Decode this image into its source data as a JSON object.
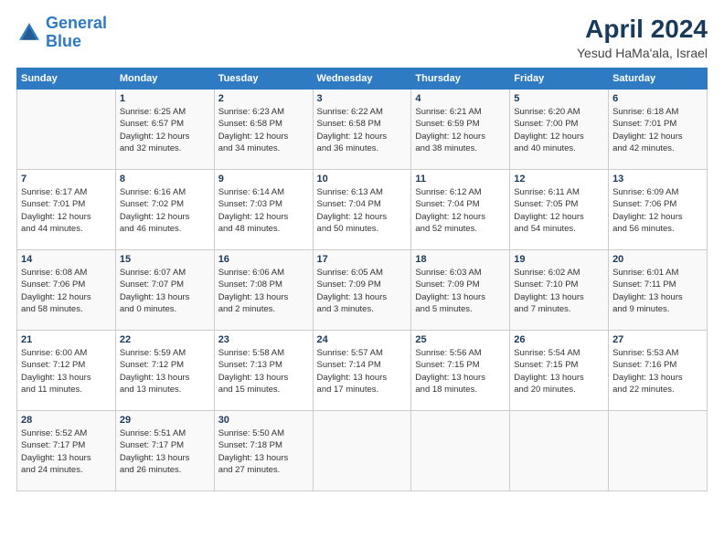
{
  "header": {
    "logo_general": "General",
    "logo_blue": "Blue",
    "title": "April 2024",
    "subtitle": "Yesud HaMa'ala, Israel"
  },
  "columns": [
    "Sunday",
    "Monday",
    "Tuesday",
    "Wednesday",
    "Thursday",
    "Friday",
    "Saturday"
  ],
  "weeks": [
    [
      {
        "day": "",
        "info": ""
      },
      {
        "day": "1",
        "info": "Sunrise: 6:25 AM\nSunset: 6:57 PM\nDaylight: 12 hours\nand 32 minutes."
      },
      {
        "day": "2",
        "info": "Sunrise: 6:23 AM\nSunset: 6:58 PM\nDaylight: 12 hours\nand 34 minutes."
      },
      {
        "day": "3",
        "info": "Sunrise: 6:22 AM\nSunset: 6:58 PM\nDaylight: 12 hours\nand 36 minutes."
      },
      {
        "day": "4",
        "info": "Sunrise: 6:21 AM\nSunset: 6:59 PM\nDaylight: 12 hours\nand 38 minutes."
      },
      {
        "day": "5",
        "info": "Sunrise: 6:20 AM\nSunset: 7:00 PM\nDaylight: 12 hours\nand 40 minutes."
      },
      {
        "day": "6",
        "info": "Sunrise: 6:18 AM\nSunset: 7:01 PM\nDaylight: 12 hours\nand 42 minutes."
      }
    ],
    [
      {
        "day": "7",
        "info": "Sunrise: 6:17 AM\nSunset: 7:01 PM\nDaylight: 12 hours\nand 44 minutes."
      },
      {
        "day": "8",
        "info": "Sunrise: 6:16 AM\nSunset: 7:02 PM\nDaylight: 12 hours\nand 46 minutes."
      },
      {
        "day": "9",
        "info": "Sunrise: 6:14 AM\nSunset: 7:03 PM\nDaylight: 12 hours\nand 48 minutes."
      },
      {
        "day": "10",
        "info": "Sunrise: 6:13 AM\nSunset: 7:04 PM\nDaylight: 12 hours\nand 50 minutes."
      },
      {
        "day": "11",
        "info": "Sunrise: 6:12 AM\nSunset: 7:04 PM\nDaylight: 12 hours\nand 52 minutes."
      },
      {
        "day": "12",
        "info": "Sunrise: 6:11 AM\nSunset: 7:05 PM\nDaylight: 12 hours\nand 54 minutes."
      },
      {
        "day": "13",
        "info": "Sunrise: 6:09 AM\nSunset: 7:06 PM\nDaylight: 12 hours\nand 56 minutes."
      }
    ],
    [
      {
        "day": "14",
        "info": "Sunrise: 6:08 AM\nSunset: 7:06 PM\nDaylight: 12 hours\nand 58 minutes."
      },
      {
        "day": "15",
        "info": "Sunrise: 6:07 AM\nSunset: 7:07 PM\nDaylight: 13 hours\nand 0 minutes."
      },
      {
        "day": "16",
        "info": "Sunrise: 6:06 AM\nSunset: 7:08 PM\nDaylight: 13 hours\nand 2 minutes."
      },
      {
        "day": "17",
        "info": "Sunrise: 6:05 AM\nSunset: 7:09 PM\nDaylight: 13 hours\nand 3 minutes."
      },
      {
        "day": "18",
        "info": "Sunrise: 6:03 AM\nSunset: 7:09 PM\nDaylight: 13 hours\nand 5 minutes."
      },
      {
        "day": "19",
        "info": "Sunrise: 6:02 AM\nSunset: 7:10 PM\nDaylight: 13 hours\nand 7 minutes."
      },
      {
        "day": "20",
        "info": "Sunrise: 6:01 AM\nSunset: 7:11 PM\nDaylight: 13 hours\nand 9 minutes."
      }
    ],
    [
      {
        "day": "21",
        "info": "Sunrise: 6:00 AM\nSunset: 7:12 PM\nDaylight: 13 hours\nand 11 minutes."
      },
      {
        "day": "22",
        "info": "Sunrise: 5:59 AM\nSunset: 7:12 PM\nDaylight: 13 hours\nand 13 minutes."
      },
      {
        "day": "23",
        "info": "Sunrise: 5:58 AM\nSunset: 7:13 PM\nDaylight: 13 hours\nand 15 minutes."
      },
      {
        "day": "24",
        "info": "Sunrise: 5:57 AM\nSunset: 7:14 PM\nDaylight: 13 hours\nand 17 minutes."
      },
      {
        "day": "25",
        "info": "Sunrise: 5:56 AM\nSunset: 7:15 PM\nDaylight: 13 hours\nand 18 minutes."
      },
      {
        "day": "26",
        "info": "Sunrise: 5:54 AM\nSunset: 7:15 PM\nDaylight: 13 hours\nand 20 minutes."
      },
      {
        "day": "27",
        "info": "Sunrise: 5:53 AM\nSunset: 7:16 PM\nDaylight: 13 hours\nand 22 minutes."
      }
    ],
    [
      {
        "day": "28",
        "info": "Sunrise: 5:52 AM\nSunset: 7:17 PM\nDaylight: 13 hours\nand 24 minutes."
      },
      {
        "day": "29",
        "info": "Sunrise: 5:51 AM\nSunset: 7:17 PM\nDaylight: 13 hours\nand 26 minutes."
      },
      {
        "day": "30",
        "info": "Sunrise: 5:50 AM\nSunset: 7:18 PM\nDaylight: 13 hours\nand 27 minutes."
      },
      {
        "day": "",
        "info": ""
      },
      {
        "day": "",
        "info": ""
      },
      {
        "day": "",
        "info": ""
      },
      {
        "day": "",
        "info": ""
      }
    ]
  ]
}
